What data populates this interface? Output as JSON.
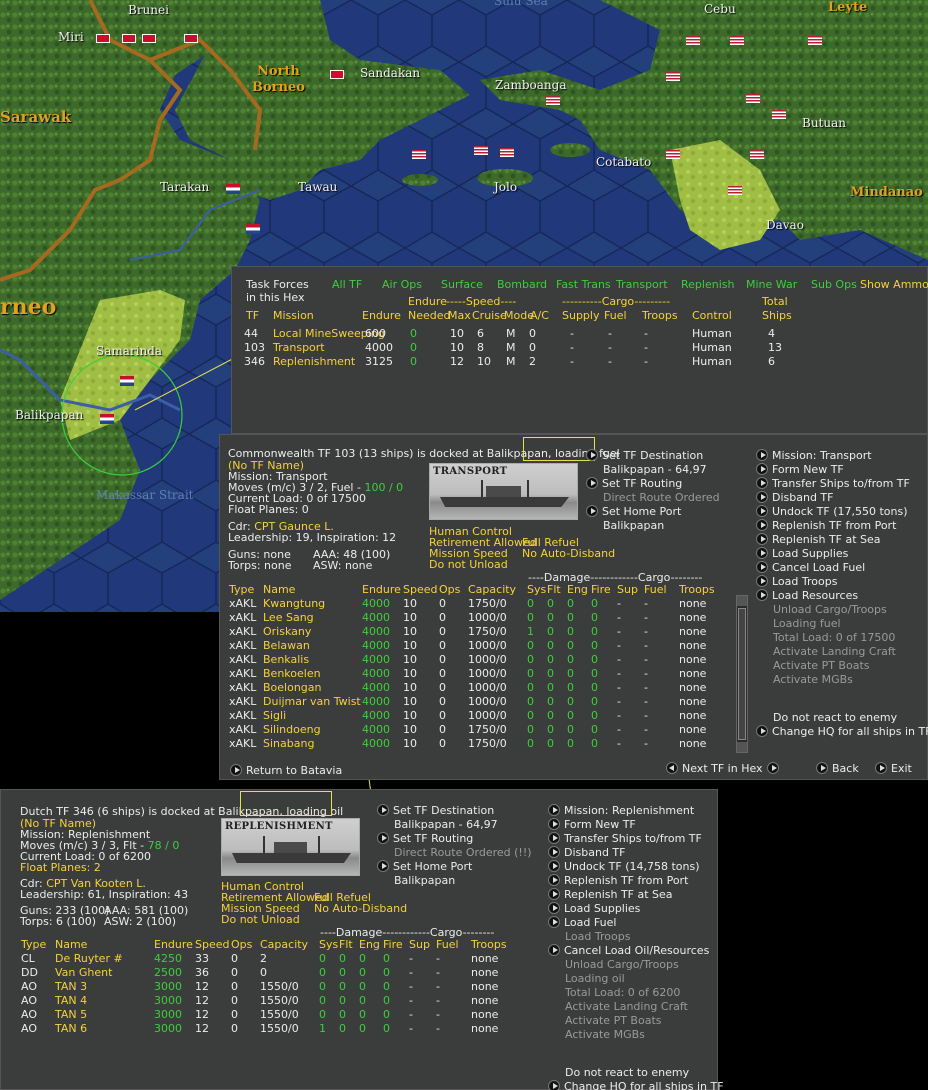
{
  "map": {
    "labels": {
      "brunei": "Brunei",
      "miri": "Miri",
      "sarawak": "Sarawak",
      "north_borneo": "North\nBorneo",
      "sandakan": "Sandakan",
      "zamboanga": "Zamboanga",
      "cebu": "Cebu",
      "leyte": "Leyte",
      "butuan": "Butuan",
      "cotabato": "Cotabato",
      "mindanao": "Mindanao",
      "davao": "Davao",
      "tarakan": "Tarakan",
      "tawau": "Tawau",
      "jolo": "Jolo",
      "borneo": "rneo",
      "samarinda": "Samarinda",
      "balikpapan": "Balikpapan",
      "makassar": "Makassar Strait",
      "sulu": "Sulu Sea"
    }
  },
  "tf_list": {
    "title": "Task Forces\nin this Hex",
    "filters": [
      "All TF",
      "Air Ops",
      "Surface",
      "Bombard",
      "Fast Trans",
      "Transport",
      "Replenish",
      "Mine War",
      "Sub Ops",
      "Show Ammo"
    ],
    "headers": {
      "endure_group": "Endure",
      "speed_group": "-----Speed----",
      "cargo_group": "----------Cargo---------",
      "total": "Total",
      "tf": "TF",
      "mission": "Mission",
      "endure": "Endure",
      "needed": "Needed",
      "max": "Max",
      "cruise": "Cruise",
      "mode": "Mode",
      "ac": "A/C",
      "supply": "Supply",
      "fuel": "Fuel",
      "troops": "Troops",
      "control": "Control",
      "ships": "Ships"
    },
    "rows": [
      {
        "tf": "44",
        "mission": "Local MineSweeping",
        "endure": "600",
        "needed": "0",
        "max": "10",
        "cruise": "6",
        "mode": "M",
        "ac": "0",
        "supply": "-",
        "fuel": "-",
        "troops": "-",
        "control": "Human",
        "ships": "4"
      },
      {
        "tf": "103",
        "mission": "Transport",
        "endure": "4000",
        "needed": "0",
        "max": "10",
        "cruise": "8",
        "mode": "M",
        "ac": "0",
        "supply": "-",
        "fuel": "-",
        "troops": "-",
        "control": "Human",
        "ships": "13"
      },
      {
        "tf": "346",
        "mission": "Replenishment",
        "endure": "3125",
        "needed": "0",
        "max": "12",
        "cruise": "10",
        "mode": "M",
        "ac": "2",
        "supply": "-",
        "fuel": "-",
        "troops": "-",
        "control": "Human",
        "ships": "6"
      }
    ]
  },
  "tf103": {
    "header": "Commonwealth TF 103 (13 ships) is docked at Balikpapan, loading fuel",
    "name": "(No TF Name)",
    "mission": "Mission:  Transport",
    "moves": "Moves (m/c)  3 / 2, Fuel - ",
    "fuel_val": "100 / 0",
    "load": "Current Load:  0 of 17500",
    "float": "Float Planes:  0",
    "cdr_label": "Cdr: ",
    "cdr": "CPT  Gaunce L.",
    "leadership": "Leadership: 19, Inspiration: 12",
    "guns": "Guns: none",
    "aaa": "AAA: 48 (100)",
    "torps": "Torps: none",
    "asw": "ASW: none",
    "pic_label": "TRANSPORT",
    "flags": [
      "Human Control",
      "Full Refuel",
      "Retirement Allowed",
      "Mission Speed",
      "No Auto-Disband",
      "Do not Unload"
    ],
    "mid_actions": {
      "set_dest": "Set TF Destination",
      "dest": "Balikpapan - 64,97",
      "set_routing": "Set TF Routing",
      "direct": "Direct Route Ordered",
      "set_home": "Set Home Port",
      "home": "Balikpapan"
    },
    "actions": [
      "Mission: Transport",
      "Form New TF",
      "Transfer Ships to/from TF",
      "Disband TF",
      "Undock TF (17,550 tons)",
      "Replenish TF from Port",
      "Replenish TF at Sea",
      "Load Supplies",
      "Cancel Load Fuel",
      "Load Troops",
      "Load Resources",
      "Unload Cargo/Troops",
      "Loading fuel",
      "Total Load: 0 of 17500",
      "Activate Landing Craft",
      "Activate PT Boats",
      "Activate MGBs"
    ],
    "react": "Do not react to enemy",
    "change_hq": "Change HQ for all ships in TF",
    "damage_hdr": "----Damage------------Cargo--------",
    "cols": {
      "type": "Type",
      "name": "Name",
      "endure": "Endure",
      "speed": "Speed",
      "ops": "Ops",
      "capacity": "Capacity",
      "sys": "Sys",
      "flt": "Flt",
      "eng": "Eng",
      "fire": "Fire",
      "sup": "Sup",
      "fuel": "Fuel",
      "troops": "Troops"
    },
    "ships": [
      {
        "type": "xAKL",
        "name": "Kwangtung",
        "endure": "4000",
        "speed": "10",
        "ops": "0",
        "capacity": "1750/0",
        "sys": "0",
        "flt": "0",
        "eng": "0",
        "fire": "0",
        "sup": "-",
        "fuel": "-",
        "troops": "none"
      },
      {
        "type": "xAKL",
        "name": "Lee Sang",
        "endure": "4000",
        "speed": "10",
        "ops": "0",
        "capacity": "1000/0",
        "sys": "0",
        "flt": "0",
        "eng": "0",
        "fire": "0",
        "sup": "-",
        "fuel": "-",
        "troops": "none"
      },
      {
        "type": "xAKL",
        "name": "Oriskany",
        "endure": "4000",
        "speed": "10",
        "ops": "0",
        "capacity": "1750/0",
        "sys": "1",
        "flt": "0",
        "eng": "0",
        "fire": "0",
        "sup": "-",
        "fuel": "-",
        "troops": "none"
      },
      {
        "type": "xAKL",
        "name": "Belawan",
        "endure": "4000",
        "speed": "10",
        "ops": "0",
        "capacity": "1000/0",
        "sys": "0",
        "flt": "0",
        "eng": "0",
        "fire": "0",
        "sup": "-",
        "fuel": "-",
        "troops": "none"
      },
      {
        "type": "xAKL",
        "name": "Benkalis",
        "endure": "4000",
        "speed": "10",
        "ops": "0",
        "capacity": "1000/0",
        "sys": "0",
        "flt": "0",
        "eng": "0",
        "fire": "0",
        "sup": "-",
        "fuel": "-",
        "troops": "none"
      },
      {
        "type": "xAKL",
        "name": "Benkoelen",
        "endure": "4000",
        "speed": "10",
        "ops": "0",
        "capacity": "1000/0",
        "sys": "0",
        "flt": "0",
        "eng": "0",
        "fire": "0",
        "sup": "-",
        "fuel": "-",
        "troops": "none"
      },
      {
        "type": "xAKL",
        "name": "Boelongan",
        "endure": "4000",
        "speed": "10",
        "ops": "0",
        "capacity": "1000/0",
        "sys": "0",
        "flt": "0",
        "eng": "0",
        "fire": "0",
        "sup": "-",
        "fuel": "-",
        "troops": "none"
      },
      {
        "type": "xAKL",
        "name": "Duijmar van Twist",
        "endure": "4000",
        "speed": "10",
        "ops": "0",
        "capacity": "1000/0",
        "sys": "0",
        "flt": "0",
        "eng": "0",
        "fire": "0",
        "sup": "-",
        "fuel": "-",
        "troops": "none"
      },
      {
        "type": "xAKL",
        "name": "Sigli",
        "endure": "4000",
        "speed": "10",
        "ops": "0",
        "capacity": "1000/0",
        "sys": "0",
        "flt": "0",
        "eng": "0",
        "fire": "0",
        "sup": "-",
        "fuel": "-",
        "troops": "none"
      },
      {
        "type": "xAKL",
        "name": "Silindoeng",
        "endure": "4000",
        "speed": "10",
        "ops": "0",
        "capacity": "1750/0",
        "sys": "0",
        "flt": "0",
        "eng": "0",
        "fire": "0",
        "sup": "-",
        "fuel": "-",
        "troops": "none"
      },
      {
        "type": "xAKL",
        "name": "Sinabang",
        "endure": "4000",
        "speed": "10",
        "ops": "0",
        "capacity": "1750/0",
        "sys": "0",
        "flt": "0",
        "eng": "0",
        "fire": "0",
        "sup": "-",
        "fuel": "-",
        "troops": "none"
      }
    ],
    "footer": {
      "return": "Return to Batavia",
      "next": "Next TF in Hex",
      "back": "Back",
      "exit": "Exit"
    }
  },
  "tf346": {
    "header": "Dutch TF 346 (6 ships) is docked at Balikpapan, loading oil",
    "name": "(No TF Name)",
    "mission": "Mission:  Replenishment",
    "moves": "Moves (m/c)  3 / 3, Flt - ",
    "fuel_val": "78 / 0",
    "load": "Current Load:  0 of 6200",
    "float": "Float Planes: 2",
    "cdr_label": "Cdr: ",
    "cdr": "CPT  Van Kooten L.",
    "leadership": "Leadership: 61, Inspiration: 43",
    "guns": "Guns: 233 (100)",
    "aaa": "AAA: 581 (100)",
    "torps": "Torps: 6 (100)",
    "asw": "ASW: 2 (100)",
    "pic_label": "REPLENISHMENT",
    "flags": [
      "Human Control",
      "Full Refuel",
      "Retirement Allowed",
      "Mission Speed",
      "No Auto-Disband",
      "Do not Unload"
    ],
    "mid_actions": {
      "set_dest": "Set TF Destination",
      "dest": "Balikpapan - 64,97",
      "set_routing": "Set TF Routing",
      "direct": "Direct Route Ordered (!!)",
      "set_home": "Set Home Port",
      "home": "Balikpapan"
    },
    "actions": [
      "Mission: Replenishment",
      "Form New TF",
      "Transfer Ships to/from TF",
      "Disband TF",
      "Undock TF (14,758 tons)",
      "Replenish TF from Port",
      "Replenish TF at Sea",
      "Load Supplies",
      "Load Fuel",
      "Load Troops",
      "Cancel Load Oil/Resources",
      "Unload Cargo/Troops",
      "Loading oil",
      "Total Load: 0 of 6200",
      "Activate Landing Craft",
      "Activate PT Boats",
      "Activate MGBs"
    ],
    "react": "Do not react to enemy",
    "change_hq": "Change HQ for all ships in TF",
    "damage_hdr": "----Damage------------Cargo--------",
    "cols": {
      "type": "Type",
      "name": "Name",
      "endure": "Endure",
      "speed": "Speed",
      "ops": "Ops",
      "capacity": "Capacity",
      "sys": "Sys",
      "flt": "Flt",
      "eng": "Eng",
      "fire": "Fire",
      "sup": "Sup",
      "fuel": "Fuel",
      "troops": "Troops"
    },
    "ships": [
      {
        "type": "CL",
        "name": "De Ruyter #",
        "endure": "4250",
        "speed": "33",
        "ops": "0",
        "capacity": "2",
        "sys": "0",
        "flt": "0",
        "eng": "0",
        "fire": "0",
        "sup": "-",
        "fuel": "-",
        "troops": "none"
      },
      {
        "type": "DD",
        "name": "Van Ghent",
        "endure": "2500",
        "speed": "36",
        "ops": "0",
        "capacity": "0",
        "sys": "0",
        "flt": "0",
        "eng": "0",
        "fire": "0",
        "sup": "-",
        "fuel": "-",
        "troops": "none"
      },
      {
        "type": "AO",
        "name": "TAN 3",
        "endure": "3000",
        "speed": "12",
        "ops": "0",
        "capacity": "1550/0",
        "sys": "0",
        "flt": "0",
        "eng": "0",
        "fire": "0",
        "sup": "-",
        "fuel": "-",
        "troops": "none"
      },
      {
        "type": "AO",
        "name": "TAN 4",
        "endure": "3000",
        "speed": "12",
        "ops": "0",
        "capacity": "1550/0",
        "sys": "0",
        "flt": "0",
        "eng": "0",
        "fire": "0",
        "sup": "-",
        "fuel": "-",
        "troops": "none"
      },
      {
        "type": "AO",
        "name": "TAN 5",
        "endure": "3000",
        "speed": "12",
        "ops": "0",
        "capacity": "1550/0",
        "sys": "0",
        "flt": "0",
        "eng": "0",
        "fire": "0",
        "sup": "-",
        "fuel": "-",
        "troops": "none"
      },
      {
        "type": "AO",
        "name": "TAN 6",
        "endure": "3000",
        "speed": "12",
        "ops": "0",
        "capacity": "1550/0",
        "sys": "1",
        "flt": "0",
        "eng": "0",
        "fire": "0",
        "sup": "-",
        "fuel": "-",
        "troops": "none"
      }
    ]
  },
  "colors": {
    "label": "#f5d23a",
    "value": "#3ccf3c",
    "text": "#ececec",
    "disabled": "#9a9a9a",
    "panel": "#3b3c3c",
    "sea": "#1f3c78",
    "land": "#3e6a2c"
  }
}
